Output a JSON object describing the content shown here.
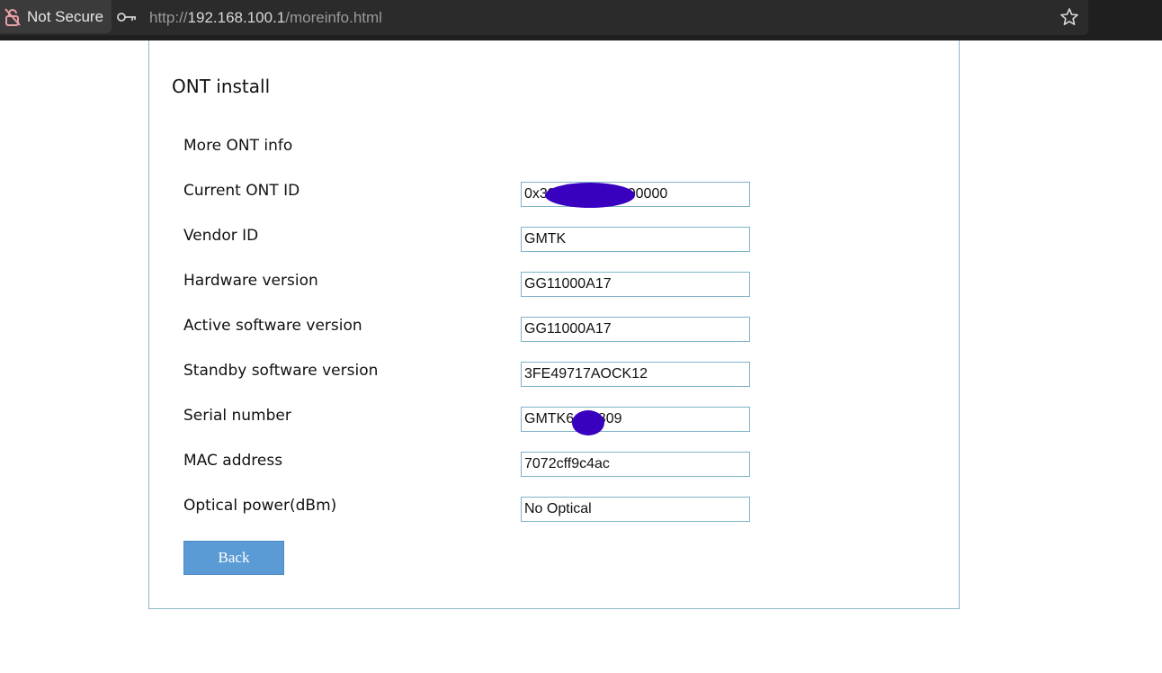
{
  "browser": {
    "security_label": "Not Secure",
    "url_prefix": "http://",
    "url_host": "192.168.100.1",
    "url_path": "/moreinfo.html"
  },
  "page": {
    "title": "ONT install",
    "section_title": "More ONT info",
    "back_label": "Back",
    "fields": [
      {
        "label": "Current ONT ID",
        "value": "0x39          537000000"
      },
      {
        "label": "Vendor ID",
        "value": "GMTK"
      },
      {
        "label": "Hardware version",
        "value": "GG11000A17"
      },
      {
        "label": "Active software version",
        "value": "GG11000A17"
      },
      {
        "label": "Standby software version",
        "value": "3FE49717AOCK12"
      },
      {
        "label": "Serial number",
        "value": "GMTK6    0809"
      },
      {
        "label": "MAC address",
        "value": "7072cff9c4ac"
      },
      {
        "label": "Optical power(dBm)",
        "value": "No Optical"
      }
    ]
  },
  "colors": {
    "accent": "#5b9bd5",
    "border": "#8fb9c9",
    "redaction": "#3a00c0"
  },
  "icons": {
    "lock": "broken-lock-icon",
    "key": "key-icon",
    "star": "star-icon"
  }
}
